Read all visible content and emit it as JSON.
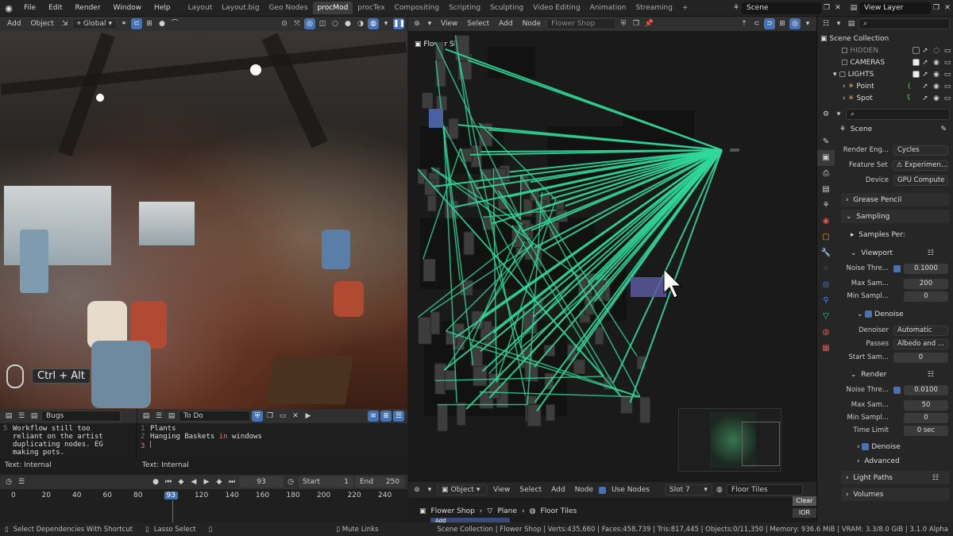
{
  "topbar": {
    "menus": [
      "File",
      "Edit",
      "Render",
      "Window",
      "Help"
    ],
    "workspaces": [
      "Layout",
      "Layout.big",
      "Geo Nodes",
      "procMod",
      "procTex",
      "Compositing",
      "Scripting",
      "Sculpting",
      "Video Editing",
      "Animation",
      "Streaming"
    ],
    "active_workspace": "procMod",
    "add_tab": "+",
    "scene": "Scene",
    "view_layer": "View Layer"
  },
  "viewport": {
    "header": {
      "add": "Add",
      "object": "Object",
      "orientation": "Global"
    },
    "overlay_hint": "Ctrl + Alt"
  },
  "text_editor_1": {
    "name": "Bugs",
    "lines": [
      {
        "n": "5",
        "t": "Workflow still too"
      },
      {
        "n": "",
        "t": "reliant on the artist"
      },
      {
        "n": "",
        "t": "duplicating nodes. EG"
      },
      {
        "n": "",
        "t": "making pots."
      }
    ],
    "footer": "Text: Internal"
  },
  "text_editor_2": {
    "name": "To Do",
    "lines": [
      {
        "n": "1",
        "a": "Plants",
        "kw": "",
        "b": ""
      },
      {
        "n": "2",
        "a": "Hanging Baskets ",
        "kw": "in",
        "b": " windows"
      },
      {
        "n": "3",
        "a": "",
        "kw": "",
        "b": ""
      }
    ],
    "footer": "Text: Internal"
  },
  "timeline": {
    "current_frame": "93",
    "start_label": "Start",
    "start": "1",
    "end_label": "End",
    "end": "250",
    "ticks": [
      "0",
      "20",
      "40",
      "60",
      "80",
      "93",
      "120",
      "140",
      "160",
      "180",
      "200",
      "220",
      "240"
    ]
  },
  "node_editor": {
    "header": {
      "view": "View",
      "select": "Select",
      "add": "Add",
      "node": "Node",
      "tree_name": "Flower Shop"
    },
    "label": "Flower Shop",
    "footer": {
      "object": "Object",
      "view": "View",
      "select": "Select",
      "add": "Add",
      "node": "Node",
      "use_nodes": "Use Nodes",
      "slot": "Slot 7",
      "material": "Floor Tiles"
    },
    "breadcrumb": [
      "Flower Shop",
      "Plane",
      "Floor Tiles"
    ],
    "side_buttons": [
      "Clear",
      "IOR"
    ],
    "add_button": "Add"
  },
  "outliner": {
    "root": "Scene Collection",
    "items": [
      {
        "name": "HIDDEN",
        "indent": 1
      },
      {
        "name": "CAMERAS",
        "indent": 1
      },
      {
        "name": "LIGHTS",
        "indent": 1
      },
      {
        "name": "Point",
        "indent": 2
      },
      {
        "name": "Spot",
        "indent": 2
      }
    ]
  },
  "properties": {
    "context": "Scene",
    "render_engine_label": "Render Eng...",
    "render_engine": "Cycles",
    "feature_set_label": "Feature Set",
    "feature_set": "Experimen...",
    "device_label": "Device",
    "device": "GPU Compute",
    "grease_pencil": "Grease Pencil",
    "sampling": "Sampling",
    "samples_per": "Samples Per:",
    "viewport": "Viewport",
    "vp_noise_label": "Noise Thre...",
    "vp_noise": "0.1000",
    "vp_max_label": "Max Sam...",
    "vp_max": "200",
    "vp_min_label": "Min Sampl...",
    "vp_min": "0",
    "denoise": "Denoise",
    "denoiser_label": "Denoiser",
    "denoiser": "Automatic",
    "passes_label": "Passes",
    "passes": "Albedo and ...",
    "start_label": "Start Sam...",
    "start": "0",
    "render": "Render",
    "r_noise_label": "Noise Thre...",
    "r_noise": "0.0100",
    "r_max_label": "Max Sam...",
    "r_max": "50",
    "r_min_label": "Min Sampl...",
    "r_min": "0",
    "time_label": "Time Limit",
    "time": "0 sec",
    "denoise2": "Denoise",
    "advanced": "Advanced",
    "light_paths": "Light Paths",
    "volumes": "Volumes"
  },
  "status": {
    "left1": "Select Dependencies With Shortcut",
    "left2": "Lasso Select",
    "left3": "Mute Links",
    "stats": "Scene Collection | Flower Shop | Verts:435,660 | Faces:458,739 | Tris:817,445 | Objects:0/11,350 | Memory: 936.6 MiB | VRAM: 3.3/8.0 GiB | 3.1.0 Alpha"
  },
  "colors": {
    "accent": "#4772b3",
    "link": "#2fd99b",
    "header": "#303030",
    "bg": "#1d1d1d"
  }
}
